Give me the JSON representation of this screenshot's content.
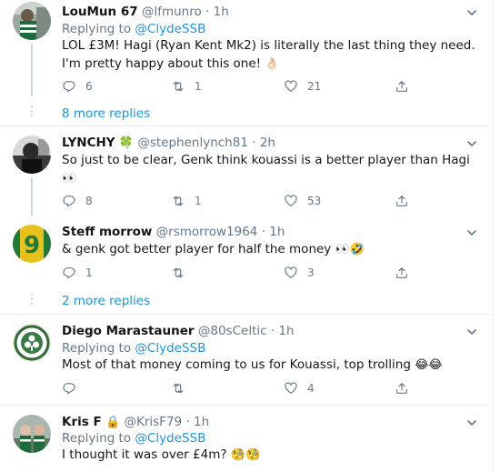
{
  "tweets": [
    {
      "name": "LouMun 67",
      "handle": "@lfmunro",
      "time": "1h",
      "replying_prefix": "Replying to",
      "replying_to": "@ClydeSSB",
      "text": "LOL £3M! Hagi (Ryan Kent Mk2) is literally the last thing they need. I'm pretty happy about this one!",
      "text_emoji": "👌🏻",
      "replies": "6",
      "retweets": "1",
      "likes": "21"
    },
    {
      "name": "LYNCHY",
      "name_emoji": "🍀",
      "handle": "@stephenlynch81",
      "time": "2h",
      "text": "So just to be clear,  Genk think kouassi is a better player than Hagi",
      "text_emoji": "👀",
      "replies": "8",
      "retweets": "1",
      "likes": "53"
    },
    {
      "name": "Steff morrow",
      "handle": "@rsmorrow1964",
      "time": "1h",
      "text": "& genk got better player for half the money",
      "text_emoji": "👀🤣",
      "replies": "1",
      "retweets": "",
      "likes": "3"
    },
    {
      "name": "Diego Marastauner",
      "handle": "@80sCeltic",
      "time": "1h",
      "replying_prefix": "Replying to",
      "replying_to": "@ClydeSSB",
      "text": "Most of that money coming to us for Kouassi, top trolling",
      "text_emoji": "😂😂",
      "replies": "",
      "retweets": "",
      "likes": "4"
    },
    {
      "name": "Kris F",
      "name_emoji": "🔒",
      "handle": "@KrisF79",
      "time": "1h",
      "replying_prefix": "Replying to",
      "replying_to": "@ClydeSSB",
      "text": "I thought it was over £4m?",
      "text_emoji": "🧐🧐"
    }
  ],
  "more_replies": [
    {
      "label": "8 more replies"
    },
    {
      "label": "2 more replies"
    }
  ],
  "separator_dot": "·",
  "colors": {
    "link": "#1b95e0",
    "muted": "#657786",
    "text": "#14171a",
    "separator": "#e6ecf0",
    "thread_line": "#ccd6dd"
  },
  "icons": [
    "reply-icon",
    "retweet-icon",
    "like-icon",
    "share-icon",
    "chevron-down-icon"
  ]
}
